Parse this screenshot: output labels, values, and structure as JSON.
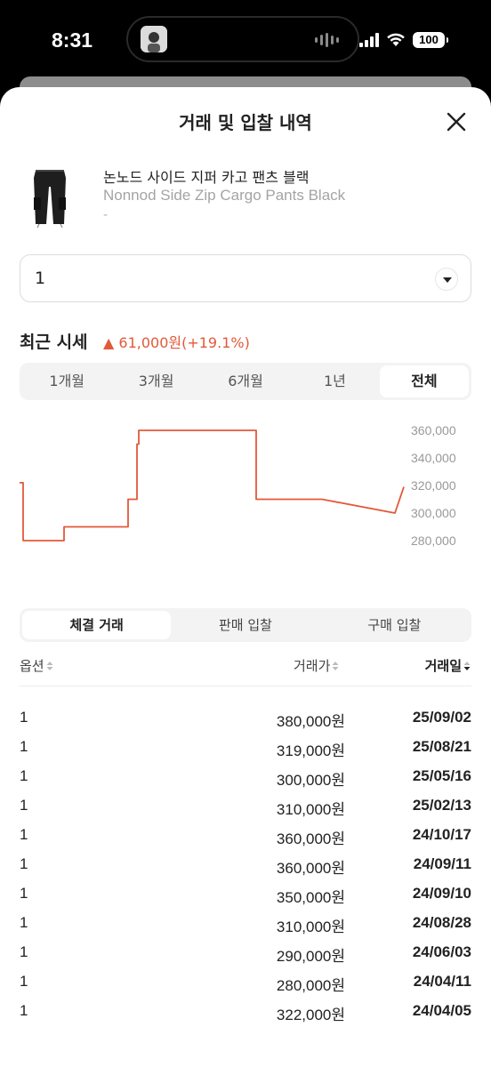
{
  "status_bar": {
    "time": "8:31",
    "battery": "100"
  },
  "sheet": {
    "title": "거래 및 입찰 내역"
  },
  "product": {
    "name_ko": "논노드 사이드 지퍼 카고 팬츠 블랙",
    "name_en": "Nonnod Side Zip Cargo Pants Black",
    "option": "-"
  },
  "size_select": {
    "value": "1"
  },
  "recent_price": {
    "title": "최근 시세",
    "change": "▲ 61,000원(+19.1%)",
    "change_color": "#e2593a"
  },
  "period_tabs": [
    {
      "label": "1개월",
      "active": false
    },
    {
      "label": "3개월",
      "active": false
    },
    {
      "label": "6개월",
      "active": false
    },
    {
      "label": "1년",
      "active": false
    },
    {
      "label": "전체",
      "active": true
    }
  ],
  "chart_data": {
    "type": "line",
    "y_ticks": [
      "360,000",
      "340,000",
      "320,000",
      "300,000",
      "280,000"
    ],
    "ylim": [
      280000,
      360000
    ],
    "line_color": "#e2593a",
    "grid": false,
    "y_axis_side": "right",
    "series": [
      {
        "values": [
          322000,
          280000,
          280000,
          290000,
          290000,
          310000,
          310000,
          350000,
          360000,
          360000,
          360000,
          310000,
          310000,
          300000,
          319000
        ]
      }
    ]
  },
  "trade_tabs": [
    {
      "label": "체결 거래",
      "active": true
    },
    {
      "label": "판매 입찰",
      "active": false
    },
    {
      "label": "구매 입찰",
      "active": false
    }
  ],
  "table": {
    "headers": {
      "option": "옵션",
      "price": "거래가",
      "date": "거래일"
    },
    "rows": [
      {
        "option": "1",
        "price": "380,000원",
        "date": "25/09/02"
      },
      {
        "option": "1",
        "price": "319,000원",
        "date": "25/08/21"
      },
      {
        "option": "1",
        "price": "300,000원",
        "date": "25/05/16"
      },
      {
        "option": "1",
        "price": "310,000원",
        "date": "25/02/13"
      },
      {
        "option": "1",
        "price": "360,000원",
        "date": "24/10/17"
      },
      {
        "option": "1",
        "price": "360,000원",
        "date": "24/09/11"
      },
      {
        "option": "1",
        "price": "350,000원",
        "date": "24/09/10"
      },
      {
        "option": "1",
        "price": "310,000원",
        "date": "24/08/28"
      },
      {
        "option": "1",
        "price": "290,000원",
        "date": "24/06/03"
      },
      {
        "option": "1",
        "price": "280,000원",
        "date": "24/04/11"
      },
      {
        "option": "1",
        "price": "322,000원",
        "date": "24/04/05"
      }
    ]
  }
}
